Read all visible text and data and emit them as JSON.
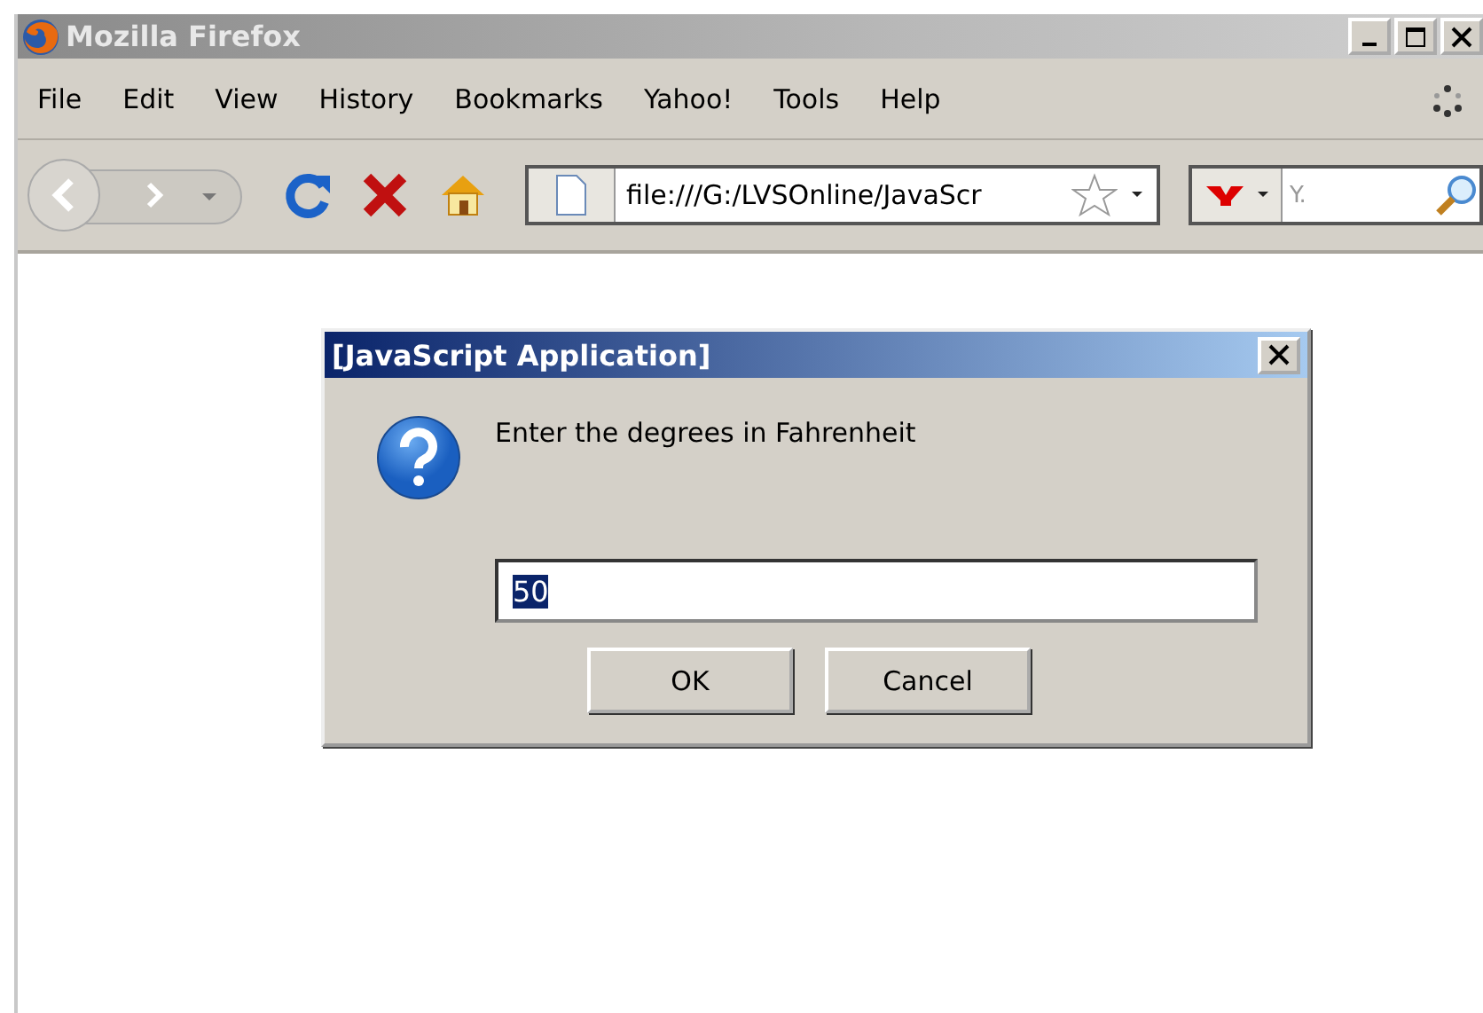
{
  "window": {
    "title": "Mozilla Firefox"
  },
  "menu": [
    "File",
    "Edit",
    "View",
    "History",
    "Bookmarks",
    "Yahoo!",
    "Tools",
    "Help"
  ],
  "address": {
    "value": "file:///G:/LVSOnline/JavaScr"
  },
  "search": {
    "placeholder": "Y."
  },
  "dialog": {
    "title": "[JavaScript Application]",
    "message": "Enter the degrees in Fahrenheit",
    "input": {
      "value": "50",
      "selected": true
    },
    "buttons": [
      "OK",
      "Cancel"
    ]
  }
}
